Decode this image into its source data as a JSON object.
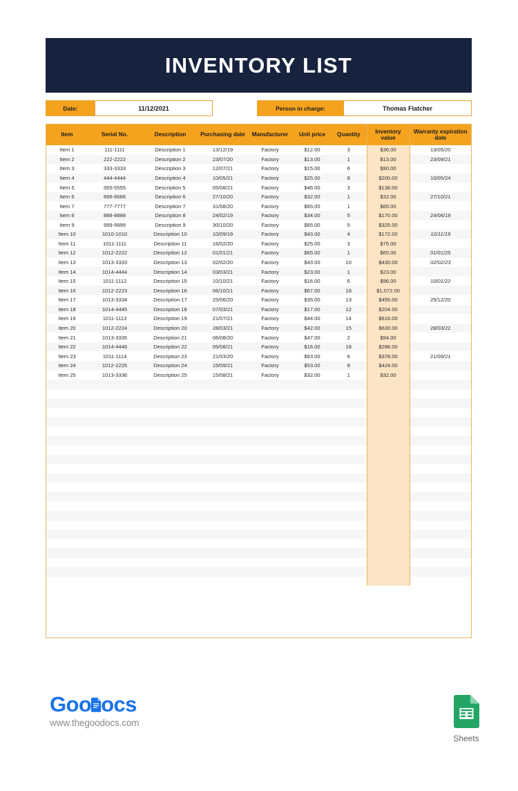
{
  "document": {
    "title": "INVENTORY LIST"
  },
  "meta": {
    "date_label": "Date:",
    "date_value": "11/12/2021",
    "person_label": "Person in charge:",
    "person_value": "Thomas Flatcher"
  },
  "table": {
    "columns": [
      "Item",
      "Serial No.",
      "Description",
      "Purchasing date",
      "Manufacturer",
      "Unit price",
      "Quantity",
      "Inventory value",
      "Warranty expiration date"
    ],
    "rows": [
      {
        "item": "Item 1",
        "serial": "111-1111",
        "description": "Description 1",
        "purchasing_date": "13/12/19",
        "manufacturer": "Factory",
        "unit_price": "$12.00",
        "quantity": "3",
        "inventory_value": "$36.00",
        "warranty": "13/05/20",
        "expired": false
      },
      {
        "item": "Item 2",
        "serial": "222-2222",
        "description": "Description 2",
        "purchasing_date": "23/07/20",
        "manufacturer": "Factory",
        "unit_price": "$13.00",
        "quantity": "1",
        "inventory_value": "$13.00",
        "warranty": "23/09/21",
        "expired": false
      },
      {
        "item": "Item 3",
        "serial": "333-3333",
        "description": "Description 3",
        "purchasing_date": "12/07/21",
        "manufacturer": "Factory",
        "unit_price": "$15.00",
        "quantity": "6",
        "inventory_value": "$90.00",
        "warranty": "",
        "expired": false
      },
      {
        "item": "Item 4",
        "serial": "444-4444",
        "description": "Description 4",
        "purchasing_date": "10/05/21",
        "manufacturer": "Factory",
        "unit_price": "$25.00",
        "quantity": "8",
        "inventory_value": "$200.00",
        "warranty": "10/05/24",
        "expired": false
      },
      {
        "item": "Item 5",
        "serial": "555-5555",
        "description": "Description 5",
        "purchasing_date": "05/08/21",
        "manufacturer": "Factory",
        "unit_price": "$46.00",
        "quantity": "3",
        "inventory_value": "$138.00",
        "warranty": "",
        "expired": false
      },
      {
        "item": "Item 6",
        "serial": "666-6666",
        "description": "Description 6",
        "purchasing_date": "27/10/20",
        "manufacturer": "Factory",
        "unit_price": "$32.00",
        "quantity": "1",
        "inventory_value": "$32.00",
        "warranty": "27/10/21",
        "expired": false
      },
      {
        "item": "Item 7",
        "serial": "777-7777",
        "description": "Description 7",
        "purchasing_date": "31/08/20",
        "manufacturer": "Factory",
        "unit_price": "$65.00",
        "quantity": "1",
        "inventory_value": "$65.00",
        "warranty": "",
        "expired": false
      },
      {
        "item": "Item 8",
        "serial": "888-8888",
        "description": "Description 8",
        "purchasing_date": "24/02/19",
        "manufacturer": "Factory",
        "unit_price": "$34.00",
        "quantity": "5",
        "inventory_value": "$170.00",
        "warranty": "24/08/19",
        "expired": false
      },
      {
        "item": "Item 9",
        "serial": "999-9999",
        "description": "Description 9",
        "purchasing_date": "30/10/20",
        "manufacturer": "Factory",
        "unit_price": "$65.00",
        "quantity": "5",
        "inventory_value": "$325.00",
        "warranty": "",
        "expired": false
      },
      {
        "item": "Item 10",
        "serial": "1010-1010",
        "description": "Description 10",
        "purchasing_date": "10/09/19",
        "manufacturer": "Factory",
        "unit_price": "$43.00",
        "quantity": "4",
        "inventory_value": "$172.00",
        "warranty": "10/11/19",
        "expired": true
      },
      {
        "item": "Item 11",
        "serial": "1011-1111",
        "description": "Description 11",
        "purchasing_date": "16/02/20",
        "manufacturer": "Factory",
        "unit_price": "$25.00",
        "quantity": "3",
        "inventory_value": "$75.00",
        "warranty": "",
        "expired": false
      },
      {
        "item": "Item 12",
        "serial": "1012-2222",
        "description": "Description 12",
        "purchasing_date": "01/01/21",
        "manufacturer": "Factory",
        "unit_price": "$65.00",
        "quantity": "1",
        "inventory_value": "$65.00",
        "warranty": "01/01/25",
        "expired": false
      },
      {
        "item": "Item 13",
        "serial": "1013-3333",
        "description": "Description 13",
        "purchasing_date": "02/02/20",
        "manufacturer": "Factory",
        "unit_price": "$43.00",
        "quantity": "10",
        "inventory_value": "$430.00",
        "warranty": "02/02/23",
        "expired": true
      },
      {
        "item": "Item 14",
        "serial": "1014-4444",
        "description": "Description 14",
        "purchasing_date": "03/03/21",
        "manufacturer": "Factory",
        "unit_price": "$23.00",
        "quantity": "1",
        "inventory_value": "$23.00",
        "warranty": "",
        "expired": false
      },
      {
        "item": "Item 15",
        "serial": "1011-1112",
        "description": "Description 15",
        "purchasing_date": "10/10/21",
        "manufacturer": "Factory",
        "unit_price": "$16.00",
        "quantity": "6",
        "inventory_value": "$96.00",
        "warranty": "10/01/22",
        "expired": true
      },
      {
        "item": "Item 16",
        "serial": "1012-2223",
        "description": "Description 16",
        "purchasing_date": "06/10/21",
        "manufacturer": "Factory",
        "unit_price": "$67.00",
        "quantity": "16",
        "inventory_value": "$1,072.00",
        "warranty": "",
        "expired": false
      },
      {
        "item": "Item 17",
        "serial": "1013-3334",
        "description": "Description 17",
        "purchasing_date": "25/06/20",
        "manufacturer": "Factory",
        "unit_price": "$35.00",
        "quantity": "13",
        "inventory_value": "$455.00",
        "warranty": "25/12/20",
        "expired": false
      },
      {
        "item": "Item 18",
        "serial": "1014-4445",
        "description": "Description 18",
        "purchasing_date": "07/03/21",
        "manufacturer": "Factory",
        "unit_price": "$17.00",
        "quantity": "12",
        "inventory_value": "$204.00",
        "warranty": "",
        "expired": false
      },
      {
        "item": "Item 19",
        "serial": "1011-1113",
        "description": "Description 19",
        "purchasing_date": "21/07/21",
        "manufacturer": "Factory",
        "unit_price": "$44.00",
        "quantity": "14",
        "inventory_value": "$616.00",
        "warranty": "",
        "expired": false
      },
      {
        "item": "Item 20",
        "serial": "1012-2224",
        "description": "Description 20",
        "purchasing_date": "28/03/21",
        "manufacturer": "Factory",
        "unit_price": "$42.00",
        "quantity": "15",
        "inventory_value": "$630.00",
        "warranty": "28/03/22",
        "expired": false
      },
      {
        "item": "Item 21",
        "serial": "1013-3335",
        "description": "Description 21",
        "purchasing_date": "06/08/20",
        "manufacturer": "Factory",
        "unit_price": "$47.00",
        "quantity": "2",
        "inventory_value": "$94.00",
        "warranty": "",
        "expired": false
      },
      {
        "item": "Item 22",
        "serial": "1014-4446",
        "description": "Description 22",
        "purchasing_date": "05/08/21",
        "manufacturer": "Factory",
        "unit_price": "$16.00",
        "quantity": "18",
        "inventory_value": "$288.00",
        "warranty": "",
        "expired": false
      },
      {
        "item": "Item 23",
        "serial": "1011-1114",
        "description": "Description 23",
        "purchasing_date": "21/03/20",
        "manufacturer": "Factory",
        "unit_price": "$63.00",
        "quantity": "6",
        "inventory_value": "$378.00",
        "warranty": "21/09/21",
        "expired": false
      },
      {
        "item": "Item 24",
        "serial": "1012-2225",
        "description": "Description 24",
        "purchasing_date": "15/09/21",
        "manufacturer": "Factory",
        "unit_price": "$53.00",
        "quantity": "8",
        "inventory_value": "$424.00",
        "warranty": "",
        "expired": false
      },
      {
        "item": "Item 25",
        "serial": "1013-3336",
        "description": "Description 25",
        "purchasing_date": "15/08/21",
        "manufacturer": "Factory",
        "unit_price": "$32.00",
        "quantity": "1",
        "inventory_value": "$32.00",
        "warranty": "",
        "expired": false
      }
    ],
    "empty_row_count": 22
  },
  "footer": {
    "brand_part1": "Goo",
    "brand_part2": "ocs",
    "url": "www.thegoodocs.com",
    "sheets_label": "Sheets"
  },
  "colors": {
    "navy": "#17233E",
    "orange": "#F5A21E",
    "peach": "#FCE5C4",
    "border": "#E5B75A",
    "expired_red": "#E0332C",
    "brand_blue": "#1A73E8",
    "sheets_green": "#23A566"
  }
}
